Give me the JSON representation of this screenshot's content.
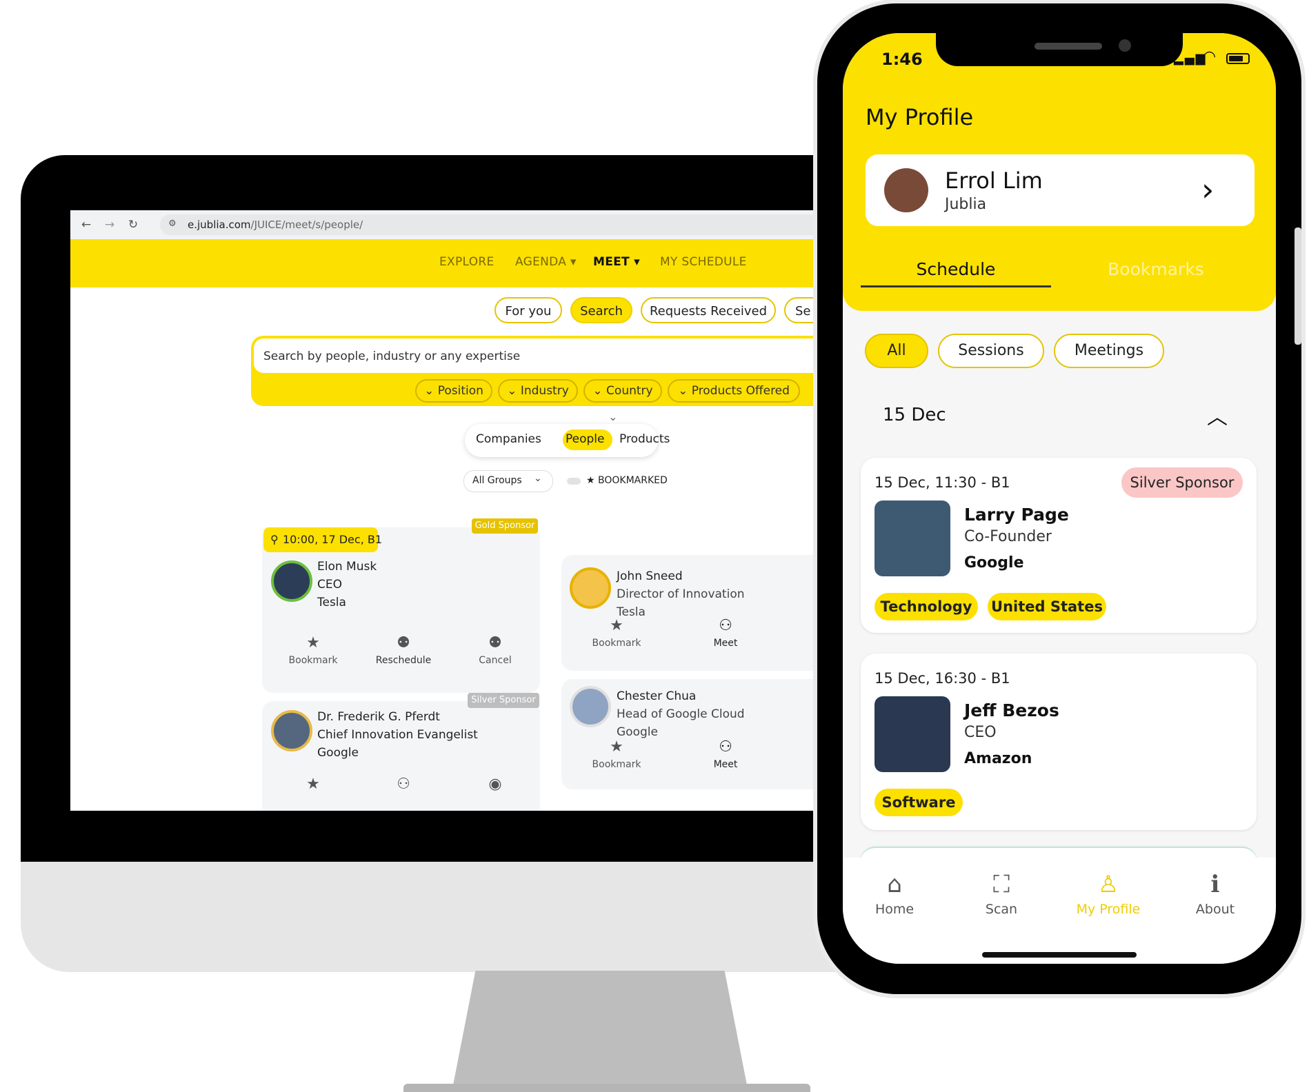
{
  "desktop": {
    "browser": {
      "url_host": "e.jublia.com",
      "url_path": "/JUICE/meet/s/people/"
    },
    "menu": [
      {
        "label": "EXPLORE"
      },
      {
        "label": "AGENDA ▾"
      },
      {
        "label": "MEET ▾"
      },
      {
        "label": "MY SCHEDULE"
      }
    ],
    "tabs": [
      {
        "label": "For you"
      },
      {
        "label": "Search"
      },
      {
        "label": "Requests Received"
      },
      {
        "label": "Se"
      }
    ],
    "search": {
      "placeholder": "Search by people, industry or any expertise"
    },
    "filters": [
      {
        "label": "⌄ Position"
      },
      {
        "label": "⌄ Industry"
      },
      {
        "label": "⌄ Country"
      },
      {
        "label": "⌄ Products Offered"
      }
    ],
    "segments": [
      {
        "label": "Companies"
      },
      {
        "label": "People"
      },
      {
        "label": "Products"
      }
    ],
    "groups_select": "All Groups",
    "bookmarked_toggle": "★ BOOKMARKED",
    "cards": {
      "elon": {
        "meeting": "10:00, 17 Dec, B1",
        "sponsor": "Gold Sponsor",
        "name": "Elon Musk",
        "title": "CEO",
        "company": "Tesla",
        "actions": [
          "Bookmark",
          "Reschedule",
          "Cancel"
        ]
      },
      "frederik": {
        "sponsor": "Silver Sponsor",
        "name": "Dr. Frederik G. Pferdt",
        "title": "Chief Innovation Evangelist",
        "company": "Google"
      },
      "john": {
        "name": "John Sneed",
        "title": "Director of Innovation",
        "company": "Tesla",
        "actions": [
          "Bookmark",
          "Meet"
        ]
      },
      "chester": {
        "name": "Chester Chua",
        "title": "Head of Google Cloud",
        "company": "Google",
        "actions": [
          "Bookmark",
          "Meet"
        ]
      }
    }
  },
  "phone": {
    "status_time": "1:46",
    "page_title": "My Profile",
    "profile": {
      "name": "Errol Lim",
      "company": "Jublia"
    },
    "tabs": [
      {
        "label": "Schedule"
      },
      {
        "label": "Bookmarks"
      }
    ],
    "chips": [
      {
        "label": "All"
      },
      {
        "label": "Sessions"
      },
      {
        "label": "Meetings"
      }
    ],
    "date_header": "15 Dec",
    "meetings": [
      {
        "time": "15 Dec, 11:30 - B1",
        "badge": "Silver Sponsor",
        "name": "Larry Page",
        "title": "Co-Founder",
        "company": "Google",
        "tags": [
          "Technology",
          "United States"
        ]
      },
      {
        "time": "15 Dec, 16:30 - B1",
        "name": "Jeff Bezos",
        "title": "CEO",
        "company": "Amazon",
        "tags": [
          "Software"
        ]
      }
    ],
    "tabbar": [
      {
        "label": "Home"
      },
      {
        "label": "Scan"
      },
      {
        "label": "My Profile"
      },
      {
        "label": "About"
      }
    ]
  }
}
